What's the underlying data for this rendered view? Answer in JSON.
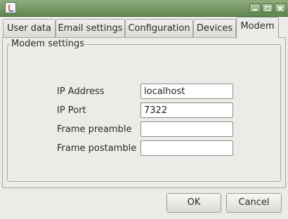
{
  "window": {
    "icon": "java-icon",
    "controls": [
      "minimize-icon",
      "maximize-icon",
      "close-icon"
    ]
  },
  "tabs": [
    {
      "label": "User data",
      "active": false
    },
    {
      "label": "Email settings",
      "active": false
    },
    {
      "label": "Configuration",
      "active": false
    },
    {
      "label": "Devices",
      "active": false
    },
    {
      "label": "Modem",
      "active": true
    }
  ],
  "modem": {
    "group_title": "Modem settings",
    "fields": [
      {
        "label": "IP Address",
        "value": "localhost"
      },
      {
        "label": "IP Port",
        "value": "7322"
      },
      {
        "label": "Frame preamble",
        "value": ""
      },
      {
        "label": "Frame postamble",
        "value": ""
      }
    ]
  },
  "buttons": {
    "ok": "OK",
    "cancel": "Cancel"
  },
  "colors": {
    "titlebar": "#6f9560",
    "panel": "#ebebe7"
  }
}
